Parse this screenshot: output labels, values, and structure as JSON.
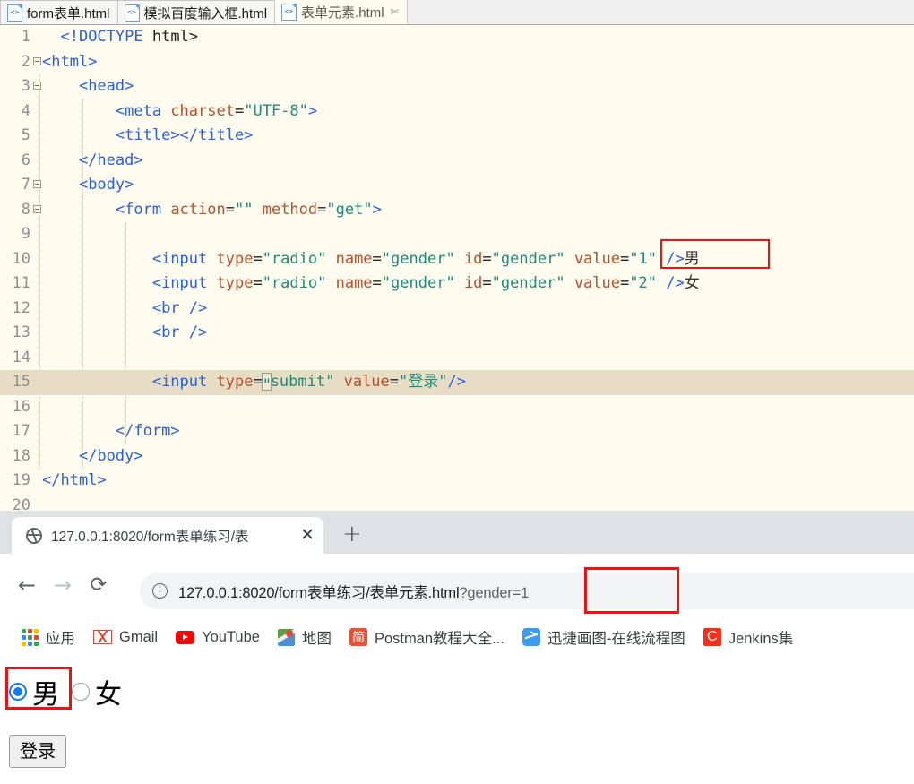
{
  "editor": {
    "tabs": [
      {
        "label": "form表单.html",
        "active": false,
        "closable": false
      },
      {
        "label": "模拟百度输入框.html",
        "active": false,
        "closable": false
      },
      {
        "label": "表单元素.html",
        "active": true,
        "closable": true,
        "close_glyph": "✄"
      }
    ],
    "highlighted_line": 15,
    "lines": [
      {
        "no": "1",
        "fold": false,
        "tokens": [
          {
            "t": "plain",
            "v": "  "
          },
          {
            "t": "doct",
            "v": "<!DOCTYPE"
          },
          {
            "t": "plain",
            "v": " html>"
          }
        ]
      },
      {
        "no": "2",
        "fold": true,
        "tokens": [
          {
            "t": "tag",
            "v": "<html>"
          }
        ]
      },
      {
        "no": "3",
        "fold": true,
        "tokens": [
          {
            "t": "plain",
            "v": "    "
          },
          {
            "t": "tag",
            "v": "<head>"
          }
        ]
      },
      {
        "no": "4",
        "fold": false,
        "tokens": [
          {
            "t": "plain",
            "v": "        "
          },
          {
            "t": "tag",
            "v": "<meta "
          },
          {
            "t": "attr",
            "v": "charset"
          },
          {
            "t": "plain",
            "v": "="
          },
          {
            "t": "str",
            "v": "\"UTF-8\""
          },
          {
            "t": "tag",
            "v": ">"
          }
        ]
      },
      {
        "no": "5",
        "fold": false,
        "tokens": [
          {
            "t": "plain",
            "v": "        "
          },
          {
            "t": "tag",
            "v": "<title></title>"
          }
        ]
      },
      {
        "no": "6",
        "fold": false,
        "tokens": [
          {
            "t": "plain",
            "v": "    "
          },
          {
            "t": "tag",
            "v": "</head>"
          }
        ]
      },
      {
        "no": "7",
        "fold": true,
        "tokens": [
          {
            "t": "plain",
            "v": "    "
          },
          {
            "t": "tag",
            "v": "<body>"
          }
        ]
      },
      {
        "no": "8",
        "fold": true,
        "tokens": [
          {
            "t": "plain",
            "v": "        "
          },
          {
            "t": "tag",
            "v": "<form "
          },
          {
            "t": "attr",
            "v": "action"
          },
          {
            "t": "plain",
            "v": "="
          },
          {
            "t": "str",
            "v": "\"\""
          },
          {
            "t": "plain",
            "v": " "
          },
          {
            "t": "attr",
            "v": "method"
          },
          {
            "t": "plain",
            "v": "="
          },
          {
            "t": "str",
            "v": "\"get\""
          },
          {
            "t": "tag",
            "v": ">"
          }
        ]
      },
      {
        "no": "9",
        "fold": false,
        "tokens": []
      },
      {
        "no": "10",
        "fold": false,
        "tokens": [
          {
            "t": "plain",
            "v": "            "
          },
          {
            "t": "tag",
            "v": "<input "
          },
          {
            "t": "attr",
            "v": "type"
          },
          {
            "t": "plain",
            "v": "="
          },
          {
            "t": "str",
            "v": "\"radio\""
          },
          {
            "t": "plain",
            "v": " "
          },
          {
            "t": "attr",
            "v": "name"
          },
          {
            "t": "plain",
            "v": "="
          },
          {
            "t": "str",
            "v": "\"gender\""
          },
          {
            "t": "plain",
            "v": " "
          },
          {
            "t": "attr",
            "v": "id"
          },
          {
            "t": "plain",
            "v": "="
          },
          {
            "t": "str",
            "v": "\"gender\""
          },
          {
            "t": "plain",
            "v": " "
          },
          {
            "t": "attr",
            "v": "value"
          },
          {
            "t": "plain",
            "v": "="
          },
          {
            "t": "str",
            "v": "\"1\""
          },
          {
            "t": "plain",
            "v": " "
          },
          {
            "t": "tag",
            "v": "/>"
          },
          {
            "t": "cn",
            "v": "男"
          }
        ]
      },
      {
        "no": "11",
        "fold": false,
        "tokens": [
          {
            "t": "plain",
            "v": "            "
          },
          {
            "t": "tag",
            "v": "<input "
          },
          {
            "t": "attr",
            "v": "type"
          },
          {
            "t": "plain",
            "v": "="
          },
          {
            "t": "str",
            "v": "\"radio\""
          },
          {
            "t": "plain",
            "v": " "
          },
          {
            "t": "attr",
            "v": "name"
          },
          {
            "t": "plain",
            "v": "="
          },
          {
            "t": "str",
            "v": "\"gender\""
          },
          {
            "t": "plain",
            "v": " "
          },
          {
            "t": "attr",
            "v": "id"
          },
          {
            "t": "plain",
            "v": "="
          },
          {
            "t": "str",
            "v": "\"gender\""
          },
          {
            "t": "plain",
            "v": " "
          },
          {
            "t": "attr",
            "v": "value"
          },
          {
            "t": "plain",
            "v": "="
          },
          {
            "t": "str",
            "v": "\"2\""
          },
          {
            "t": "plain",
            "v": " "
          },
          {
            "t": "tag",
            "v": "/>"
          },
          {
            "t": "cn",
            "v": "女"
          }
        ]
      },
      {
        "no": "12",
        "fold": false,
        "tokens": [
          {
            "t": "plain",
            "v": "            "
          },
          {
            "t": "tag",
            "v": "<br />"
          }
        ]
      },
      {
        "no": "13",
        "fold": false,
        "tokens": [
          {
            "t": "plain",
            "v": "            "
          },
          {
            "t": "tag",
            "v": "<br />"
          }
        ]
      },
      {
        "no": "14",
        "fold": false,
        "tokens": []
      },
      {
        "no": "15",
        "fold": false,
        "tokens": [
          {
            "t": "plain",
            "v": "            "
          },
          {
            "t": "tag",
            "v": "<input "
          },
          {
            "t": "attr",
            "v": "type"
          },
          {
            "t": "plain",
            "v": "="
          },
          {
            "t": "caret",
            "v": "\""
          },
          {
            "t": "str",
            "v": "submit\""
          },
          {
            "t": "plain",
            "v": " "
          },
          {
            "t": "attr",
            "v": "value"
          },
          {
            "t": "plain",
            "v": "="
          },
          {
            "t": "str",
            "v": "\""
          },
          {
            "t": "strcn",
            "v": "登录"
          },
          {
            "t": "str",
            "v": "\""
          },
          {
            "t": "tag",
            "v": "/>"
          }
        ]
      },
      {
        "no": "16",
        "fold": false,
        "tokens": []
      },
      {
        "no": "17",
        "fold": false,
        "tokens": [
          {
            "t": "plain",
            "v": "        "
          },
          {
            "t": "tag",
            "v": "</form>"
          }
        ]
      },
      {
        "no": "18",
        "fold": false,
        "tokens": [
          {
            "t": "plain",
            "v": "    "
          },
          {
            "t": "tag",
            "v": "</body>"
          }
        ]
      },
      {
        "no": "19",
        "fold": false,
        "tokens": [
          {
            "t": "tag",
            "v": "</html>"
          }
        ]
      },
      {
        "no": "20",
        "fold": false,
        "tokens": []
      }
    ],
    "annotation_label": "value=\"1\""
  },
  "browser": {
    "tab": {
      "title": "127.0.0.1:8020/form表单练习/表",
      "close_glyph": "✕",
      "favicon": "globe-icon"
    },
    "new_tab_glyph": "+",
    "nav": {
      "back_glyph": "←",
      "forward_glyph": "→",
      "reload_glyph": "⟳"
    },
    "url": {
      "base": "127.0.0.1:8020/form表单练习/表单元素.html",
      "query": "?gender=1",
      "full": "127.0.0.1:8020/form表单练习/表单元素.html?gender=1"
    },
    "bookmarks": [
      {
        "label": "应用",
        "icon": "apps-grid-icon"
      },
      {
        "label": "Gmail",
        "icon": "gmail-icon"
      },
      {
        "label": "YouTube",
        "icon": "youtube-icon"
      },
      {
        "label": "地图",
        "icon": "google-maps-icon"
      },
      {
        "label": "Postman教程大全...",
        "icon": "jianshu-icon",
        "icon_text": "简"
      },
      {
        "label": "迅捷画图-在线流程图",
        "icon": "xunjie-icon"
      },
      {
        "label": "Jenkins集",
        "icon": "jenkins-c-icon",
        "icon_text": "C"
      }
    ]
  },
  "page": {
    "radios": [
      {
        "label": "男",
        "value": "1",
        "checked": true
      },
      {
        "label": "女",
        "value": "2",
        "checked": false
      }
    ],
    "submit_label": "登录"
  },
  "colors": {
    "annotation_red": "#ee1111",
    "editor_bg": "#fffbef",
    "editor_current_line": "#e6ddc4",
    "tag_blue": "#2b5fd9",
    "attr_orange": "#b5502a",
    "string_teal": "#1d8a7a",
    "browser_chrome": "#dee1e6",
    "urlbar_bg": "#f1f3f4",
    "radio_blue": "#1878f0"
  }
}
